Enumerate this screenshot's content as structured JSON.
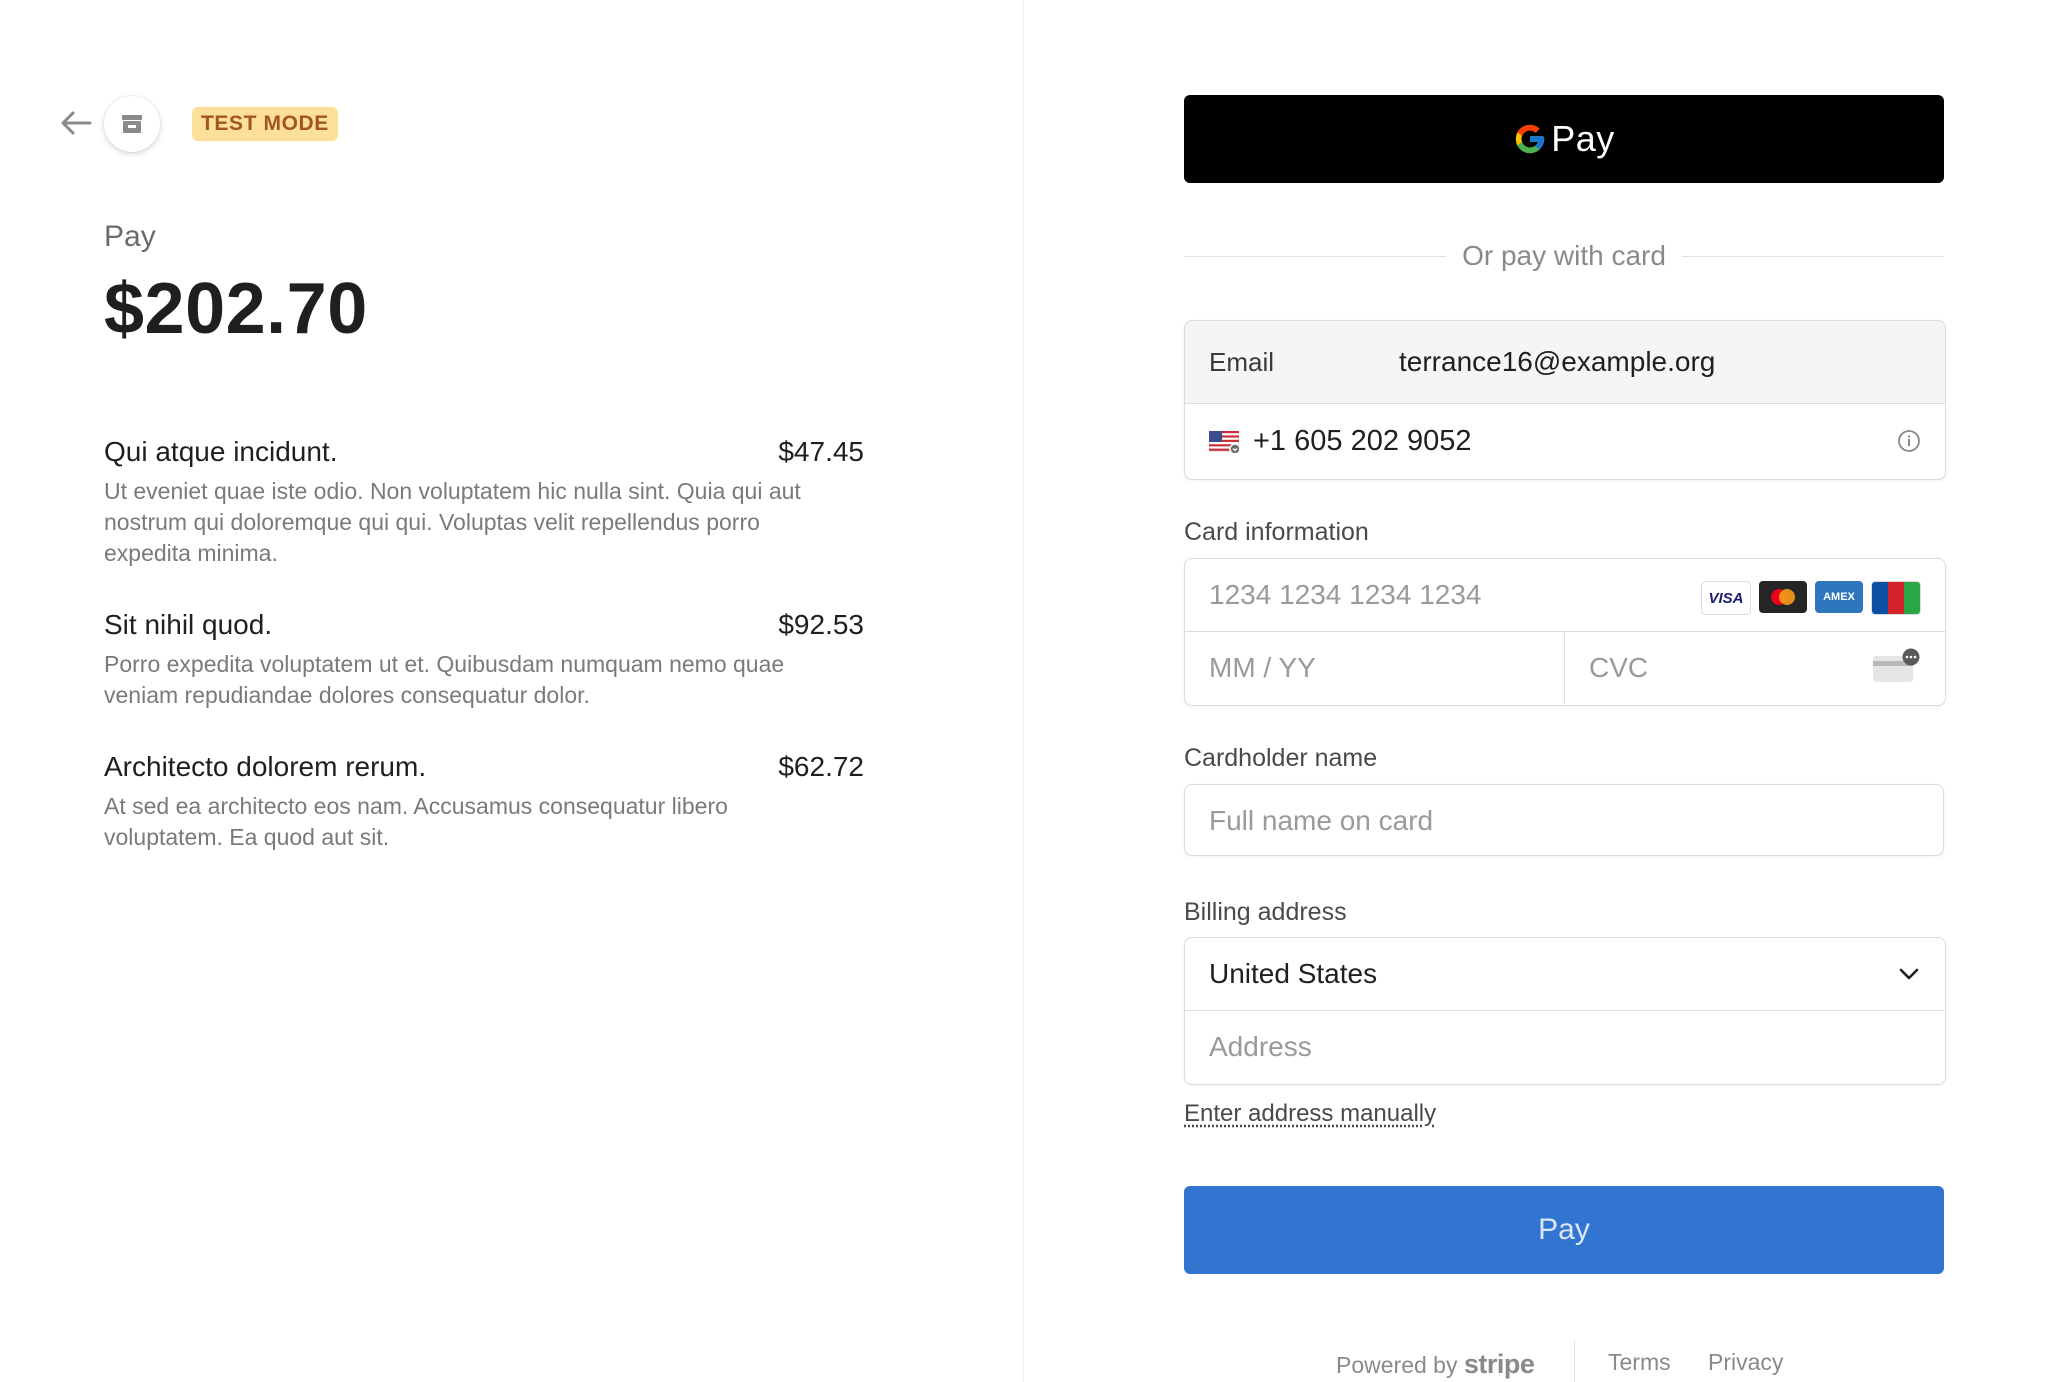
{
  "header": {
    "back_icon": "arrow-left-icon",
    "shop_icon": "store-icon",
    "test_mode_badge": "TEST MODE"
  },
  "summary": {
    "pay_label": "Pay",
    "amount": "$202.70"
  },
  "line_items": [
    {
      "name": "Qui atque incidunt.",
      "price": "$47.45",
      "description": "Ut eveniet quae iste odio. Non voluptatem hic nulla sint. Quia qui aut nostrum qui doloremque qui qui. Voluptas velit repellendus porro expedita minima."
    },
    {
      "name": "Sit nihil quod.",
      "price": "$92.53",
      "description": "Porro expedita voluptatem ut et. Quibusdam numquam nemo quae veniam repudiandae dolores consequatur dolor."
    },
    {
      "name": "Architecto dolorem rerum.",
      "price": "$62.72",
      "description": "At sed ea architecto eos nam. Accusamus consequatur libero voluptatem. Ea quod aut sit."
    }
  ],
  "wallet": {
    "gpay_label": "Pay",
    "or_text": "Or pay with card"
  },
  "contact": {
    "email_label": "Email",
    "email_value": "terrance16@example.org",
    "phone_value": "+1 605 202 9052",
    "flag_icon": "us-flag-icon",
    "info_icon": "info-icon"
  },
  "card": {
    "label": "Card information",
    "number_placeholder": "1234 1234 1234 1234",
    "expiry_placeholder": "MM / YY",
    "cvc_placeholder": "CVC",
    "brands": [
      "VISA",
      "Mastercard",
      "AMEX",
      "JCB"
    ]
  },
  "cardholder": {
    "label": "Cardholder name",
    "placeholder": "Full name on card"
  },
  "billing": {
    "label": "Billing address",
    "country": "United States",
    "address_placeholder": "Address",
    "manual_link": "Enter address manually"
  },
  "pay_button_label": "Pay",
  "footer": {
    "powered_by": "Powered by",
    "brand": "stripe",
    "terms": "Terms",
    "privacy": "Privacy"
  },
  "colors": {
    "pay_button": "#3175d1",
    "badge_bg": "#fbdf9a",
    "badge_text": "#a4561f"
  }
}
